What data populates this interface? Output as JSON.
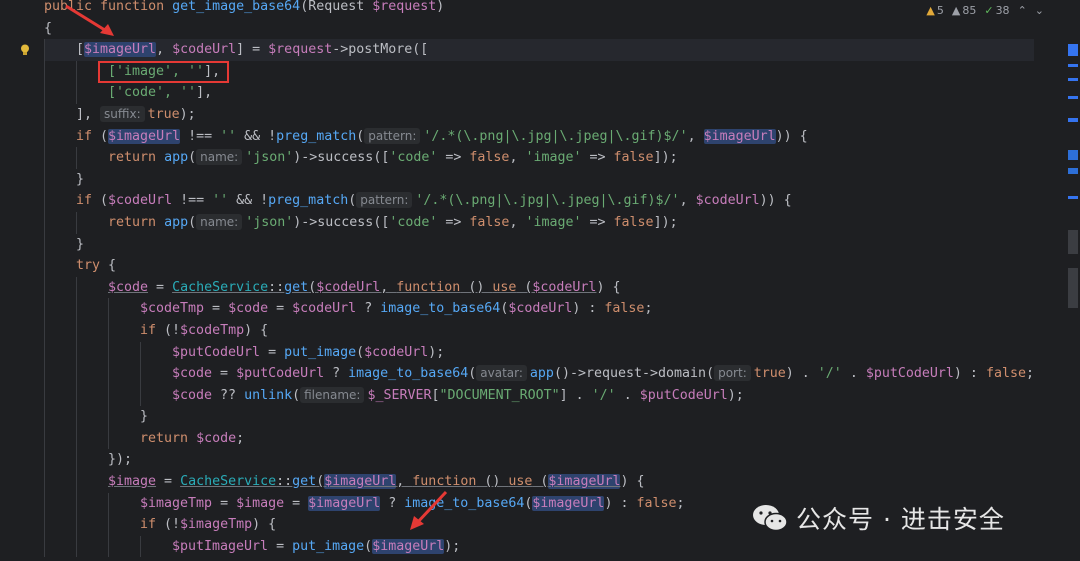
{
  "inspections": {
    "warnings": "5",
    "weak_warnings": "85",
    "typos": "38"
  },
  "watermark": {
    "text": "公众号 · 进击安全"
  },
  "colors": {
    "keyword": "#cf8e6d",
    "variable": "#c77dbb",
    "function": "#56a8f5",
    "class": "#2aacb8",
    "string": "#6aab73",
    "annotation_red": "#e53935"
  },
  "code": {
    "l1_a": "public function ",
    "l1_b": "get_image_base64",
    "l1_c": "(Request ",
    "l1_d": "$request",
    "l1_e": ")",
    "l2": "{",
    "l3_a": "[",
    "l3_b": "$imageUrl",
    "l3_c": ", ",
    "l3_d": "$codeUrl",
    "l3_e": "] = ",
    "l3_f": "$request",
    "l3_g": "->",
    "l3_h": "postMore",
    "l3_i": "([",
    "l4_a": "['image', ''",
    "l4_b": "],",
    "l5_a": "['code', ''",
    "l5_b": "],",
    "l6_a": "], ",
    "l6_hint": "suffix:",
    "l6_b": "true",
    "l6_c": ");",
    "l7_a": "if",
    "l7_b": " (",
    "l7_c": "$imageUrl",
    "l7_d": " !== ",
    "l7_e": "''",
    "l7_f": " && !",
    "l7_g": "preg_match",
    "l7_h": "(",
    "l7_hint": "pattern:",
    "l7_i": "'/.*(\\.png|\\.jpg|\\.jpeg|\\.gif)$/'",
    "l7_j": ", ",
    "l7_k": "$imageUrl",
    "l7_l": ")) {",
    "l8_a": "return",
    "l8_b": " ",
    "l8_c": "app",
    "l8_d": "(",
    "l8_hint": "name:",
    "l8_e": "'json'",
    "l8_f": ")->",
    "l8_g": "success",
    "l8_h": "([",
    "l8_i": "'code'",
    "l8_j": " => ",
    "l8_k": "false",
    "l8_l": ", ",
    "l8_m": "'image'",
    "l8_n": " => ",
    "l8_o": "false",
    "l8_p": "]);",
    "l9": "}",
    "l10_a": "if",
    "l10_b": " (",
    "l10_c": "$codeUrl",
    "l10_d": " !== ",
    "l10_e": "''",
    "l10_f": " && !",
    "l10_g": "preg_match",
    "l10_h": "(",
    "l10_hint": "pattern:",
    "l10_i": "'/.*(\\.png|\\.jpg|\\.jpeg|\\.gif)$/'",
    "l10_j": ", ",
    "l10_k": "$codeUrl",
    "l10_l": ")) {",
    "l11_a": "return",
    "l11_b": " ",
    "l11_c": "app",
    "l11_d": "(",
    "l11_hint": "name:",
    "l11_e": "'json'",
    "l11_f": ")->",
    "l11_g": "success",
    "l11_h": "([",
    "l11_i": "'code'",
    "l11_j": " => ",
    "l11_k": "false",
    "l11_l": ", ",
    "l11_m": "'image'",
    "l11_n": " => ",
    "l11_o": "false",
    "l11_p": "]);",
    "l12": "}",
    "l13_a": "try",
    "l13_b": " {",
    "l14_a": "$code",
    "l14_b": " = ",
    "l14_c": "CacheService",
    "l14_d": "::",
    "l14_e": "get",
    "l14_f": "(",
    "l14_g": "$codeUrl",
    "l14_h": ", ",
    "l14_i": "function",
    "l14_j": " () ",
    "l14_k": "use",
    "l14_l": " (",
    "l14_m": "$codeUrl",
    "l14_n": ") {",
    "l15_a": "$codeTmp",
    "l15_b": " = ",
    "l15_c": "$code",
    "l15_d": " = ",
    "l15_e": "$codeUrl",
    "l15_f": " ? ",
    "l15_g": "image_to_base64",
    "l15_h": "(",
    "l15_i": "$codeUrl",
    "l15_j": ") : ",
    "l15_k": "false",
    "l15_l": ";",
    "l16_a": "if",
    "l16_b": " (!",
    "l16_c": "$codeTmp",
    "l16_d": ") {",
    "l17_a": "$putCodeUrl",
    "l17_b": " = ",
    "l17_c": "put_image",
    "l17_d": "(",
    "l17_e": "$codeUrl",
    "l17_f": ");",
    "l18_a": "$code",
    "l18_b": " = ",
    "l18_c": "$putCodeUrl",
    "l18_d": " ? ",
    "l18_e": "image_to_base64",
    "l18_f": "(",
    "l18_hint": "avatar:",
    "l18_g": "app",
    "l18_h": "()->",
    "l18_i": "request",
    "l18_j": "->",
    "l18_k": "domain",
    "l18_l": "(",
    "l18_hint2": "port:",
    "l18_m": "true",
    "l18_n": ") . ",
    "l18_o": "'/'",
    "l18_p": " . ",
    "l18_q": "$putCodeUrl",
    "l18_r": ") : ",
    "l18_s": "false",
    "l18_t": ";",
    "l19_a": "$code",
    "l19_b": " ?? ",
    "l19_c": "unlink",
    "l19_d": "(",
    "l19_hint": "filename:",
    "l19_e": "$_SERVER",
    "l19_f": "[",
    "l19_g": "\"DOCUMENT_ROOT\"",
    "l19_h": "] . ",
    "l19_i": "'/'",
    "l19_j": " . ",
    "l19_k": "$putCodeUrl",
    "l19_l": ");",
    "l20": "}",
    "l21_a": "return",
    "l21_b": " ",
    "l21_c": "$code",
    "l21_d": ";",
    "l22": "});",
    "l23_a": "$image",
    "l23_b": " = ",
    "l23_c": "CacheService",
    "l23_d": "::",
    "l23_e": "get",
    "l23_f": "(",
    "l23_g": "$imageUrl",
    "l23_h": ", ",
    "l23_i": "function",
    "l23_j": " () ",
    "l23_k": "use",
    "l23_l": " (",
    "l23_m": "$imageUrl",
    "l23_n": ") {",
    "l24_a": "$imageTmp",
    "l24_b": " = ",
    "l24_c": "$image",
    "l24_d": " = ",
    "l24_e": "$imageUrl",
    "l24_f": " ? ",
    "l24_g": "image_to_base64",
    "l24_h": "(",
    "l24_i": "$imageUrl",
    "l24_j": ") : ",
    "l24_k": "false",
    "l24_l": ";",
    "l25_a": "if",
    "l25_b": " (!",
    "l25_c": "$imageTmp",
    "l25_d": ") {",
    "l26_a": "$putImageUrl",
    "l26_b": " = ",
    "l26_c": "put_image",
    "l26_d": "(",
    "l26_e": "$imageUrl",
    "l26_f": ");"
  }
}
